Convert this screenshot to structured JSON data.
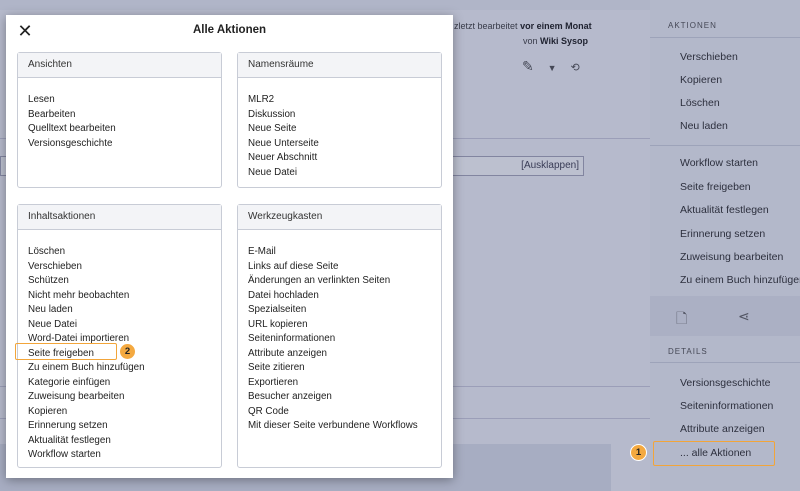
{
  "page": {
    "last_edit_prefix": "zletzt bearbeitet",
    "last_edit_time": "vor einem Monat",
    "last_edit_by_prefix": "von",
    "last_edit_by": "Wiki Sysop",
    "expand_label": "[Ausklappen]"
  },
  "sidebar": {
    "actions_heading": "AKTIONEN",
    "actions": [
      "Verschieben",
      "Kopieren",
      "Löschen",
      "Neu laden"
    ],
    "workflow_items": [
      "Workflow starten",
      "Seite freigeben",
      "Aktualität festlegen",
      "Erinnerung setzen",
      "Zuweisung bearbeiten",
      "Zu einem Buch hinzufügen"
    ],
    "details_heading": "DETAILS",
    "details": [
      "Versionsgeschichte",
      "Seiteninformationen",
      "Attribute anzeigen",
      "... alle Aktionen"
    ]
  },
  "modal": {
    "title": "Alle Aktionen",
    "groups": {
      "ansichten": {
        "title": "Ansichten",
        "items": [
          "Lesen",
          "Bearbeiten",
          "Quelltext bearbeiten",
          "Versionsgeschichte"
        ]
      },
      "namespaces": {
        "title": "Namensräume",
        "items": [
          "MLR2",
          "Diskussion",
          "Neue Seite",
          "Neue Unterseite",
          "Neuer Abschnitt",
          "Neue Datei"
        ]
      },
      "inhalt": {
        "title": "Inhaltsaktionen",
        "items": [
          "Löschen",
          "Verschieben",
          "Schützen",
          "Nicht mehr beobachten",
          "Neu laden",
          "Neue Datei",
          "Word-Datei importieren",
          "Seite freigeben",
          "Zu einem Buch hinzufügen",
          "Kategorie einfügen",
          "Zuweisung bearbeiten",
          "Kopieren",
          "Erinnerung setzen",
          "Aktualität festlegen",
          "Workflow starten"
        ]
      },
      "werkzeug": {
        "title": "Werkzeugkasten",
        "items": [
          "E-Mail",
          "Links auf diese Seite",
          "Änderungen an verlinkten Seiten",
          "Datei hochladen",
          "Spezialseiten",
          "URL kopieren",
          "Seiteninformationen",
          "Attribute anzeigen",
          "Seite zitieren",
          "Exportieren",
          "Besucher anzeigen",
          "QR Code",
          "Mit dieser Seite verbundene Workflows"
        ]
      }
    }
  },
  "callouts": {
    "badge1": "1",
    "badge2": "2",
    "color": "#f2a53a"
  }
}
